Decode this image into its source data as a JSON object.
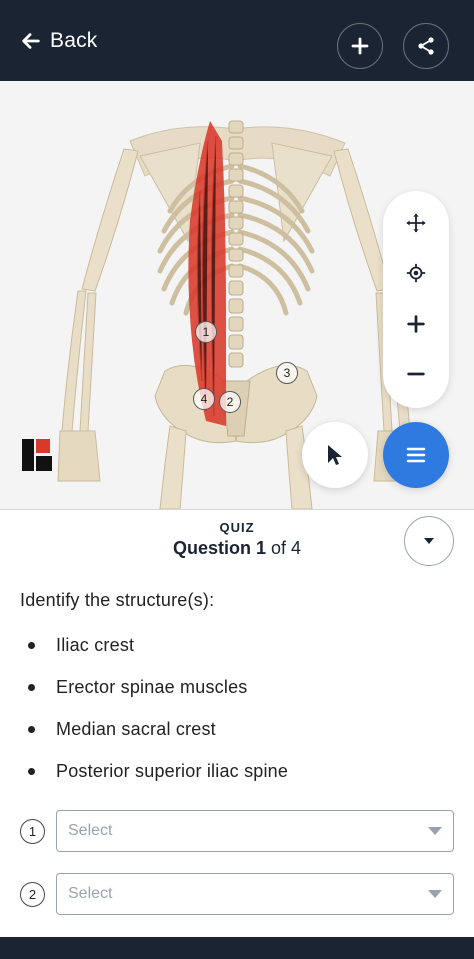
{
  "header": {
    "back_label": "Back",
    "add_icon": "plus-icon",
    "share_icon": "share-icon"
  },
  "viewer": {
    "markers": [
      "1",
      "2",
      "3",
      "4"
    ],
    "tools": [
      "move-icon",
      "locate-icon",
      "zoom-in-icon",
      "zoom-out-icon"
    ],
    "highlight_color": "#d9392b",
    "menu_button_color": "#2f7ae0"
  },
  "quiz": {
    "label": "QUIZ",
    "question_word": "Question 1",
    "question_total": "of 4",
    "prompt": "Identify the structure(s):",
    "options": [
      "Iliac crest",
      "Erector spinae muscles",
      "Median sacral crest",
      "Posterior superior iliac spine"
    ],
    "answers": [
      {
        "number": "1",
        "placeholder": "Select"
      },
      {
        "number": "2",
        "placeholder": "Select"
      }
    ]
  }
}
